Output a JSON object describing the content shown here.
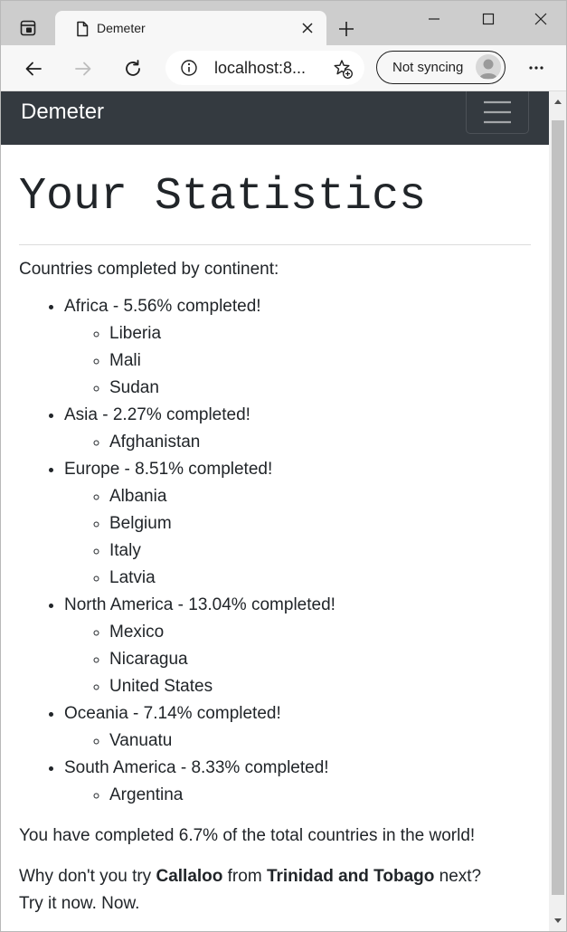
{
  "browser": {
    "tab_title": "Demeter",
    "url": "localhost:8...",
    "profile_label": "Not syncing"
  },
  "site": {
    "brand": "Demeter"
  },
  "page": {
    "heading": "Your Statistics",
    "intro": "Countries completed by continent:",
    "continents": [
      {
        "label": "Africa - 5.56% completed!",
        "countries": [
          "Liberia",
          "Mali",
          "Sudan"
        ]
      },
      {
        "label": "Asia - 2.27% completed!",
        "countries": [
          "Afghanistan"
        ]
      },
      {
        "label": "Europe - 8.51% completed!",
        "countries": [
          "Albania",
          "Belgium",
          "Italy",
          "Latvia"
        ]
      },
      {
        "label": "North America - 13.04% completed!",
        "countries": [
          "Mexico",
          "Nicaragua",
          "United States"
        ]
      },
      {
        "label": "Oceania - 7.14% completed!",
        "countries": [
          "Vanuatu"
        ]
      },
      {
        "label": "South America - 8.33% completed!",
        "countries": [
          "Argentina"
        ]
      }
    ],
    "summary": "You have completed 6.7% of the total countries in the world!",
    "suggestion": {
      "prefix": "Why don't you try ",
      "dish": "Callaloo",
      "middle": " from ",
      "country": "Trinidad and Tobago",
      "suffix": " next?"
    },
    "try_line": "Try it now. Now."
  },
  "colors": {
    "navbar_bg": "#343a40",
    "text": "#212529",
    "tabstrip_bg": "#cdcdcd",
    "toolbar_bg": "#f7f7f7"
  },
  "icons": {
    "tab_actions": "tab-actions-icon",
    "favicon": "page-icon",
    "close": "close-icon",
    "new_tab": "plus-icon",
    "back": "back-arrow-icon",
    "forward": "forward-arrow-icon",
    "refresh": "refresh-icon",
    "site_info": "info-icon",
    "favorites": "star-plus-icon",
    "more": "ellipsis-icon",
    "menu": "hamburger-icon"
  }
}
